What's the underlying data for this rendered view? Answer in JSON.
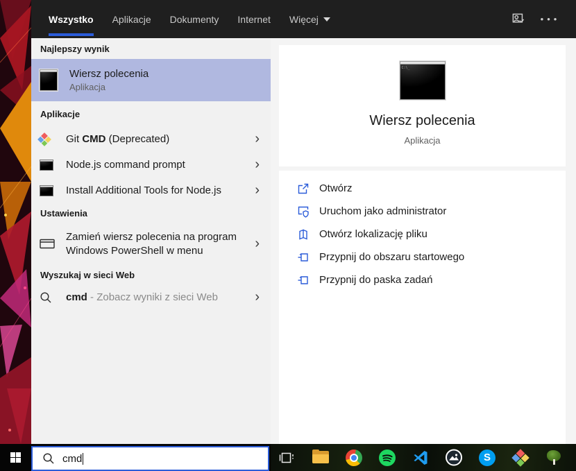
{
  "theme": {
    "accent": "#2b5cd9",
    "header_bg": "#1f1f1f",
    "left_panel_bg": "#f1f1f1",
    "right_panel_bg": "#f4f4f4",
    "selection_highlight": "#b0b8e0",
    "wallpaper_colors": [
      "#20060d",
      "#e0890c",
      "#b01b2e",
      "#d62a8c"
    ]
  },
  "header": {
    "tabs": [
      {
        "label": "Wszystko",
        "active": true
      },
      {
        "label": "Aplikacje",
        "active": false
      },
      {
        "label": "Dokumenty",
        "active": false
      },
      {
        "label": "Internet",
        "active": false
      },
      {
        "label": "Więcej",
        "active": false,
        "has_dropdown": true
      }
    ],
    "icons": [
      "user-account-icon",
      "ellipsis-icon"
    ],
    "ellipsis_glyph": "•••"
  },
  "left_panel": {
    "best": {
      "section": "Najlepszy wynik",
      "item": {
        "title": "Wiersz polecenia",
        "subtitle": "Aplikacja",
        "icon": "cmd-window-icon",
        "selected": true
      }
    },
    "apps": {
      "section": "Aplikacje",
      "items": [
        {
          "pre": "Git ",
          "bold": "CMD",
          "post": " (Deprecated)",
          "icon": "git-icon"
        },
        {
          "title": "Node.js command prompt",
          "icon": "cmd-window-icon"
        },
        {
          "title": "Install Additional Tools for Node.js",
          "icon": "cmd-window-icon"
        }
      ]
    },
    "settings": {
      "section": "Ustawienia",
      "item": {
        "line1": "Zamień wiersz polecenia na program",
        "line2": "Windows PowerShell w menu",
        "icon": "window-icon"
      }
    },
    "web": {
      "section": "Wyszukaj w sieci Web",
      "item": {
        "query": "cmd",
        "separator": " - ",
        "rest": "Zobacz wyniki z sieci Web",
        "icon": "search-icon"
      }
    },
    "chevron_glyph": "›"
  },
  "right_panel": {
    "app": {
      "title": "Wiersz polecenia",
      "subtitle": "Aplikacja",
      "icon": "cmd-window-icon",
      "icon_text": "C:\\_"
    },
    "actions": [
      {
        "label": "Otwórz",
        "icon": "open-icon"
      },
      {
        "label": "Uruchom jako administrator",
        "icon": "admin-shield-icon"
      },
      {
        "label": "Otwórz lokalizację pliku",
        "icon": "file-location-icon"
      },
      {
        "label": "Przypnij do obszaru startowego",
        "icon": "pin-icon"
      },
      {
        "label": "Przypnij do paska zadań",
        "icon": "pin-icon"
      }
    ]
  },
  "taskbar": {
    "search": {
      "value": "cmd",
      "icon": "search-icon"
    },
    "buttons": [
      "start",
      "task-view",
      "file-explorer",
      "chrome",
      "spotify",
      "vscode",
      "photos",
      "skype",
      "git",
      "tree-app"
    ],
    "skype_letter": "S"
  }
}
